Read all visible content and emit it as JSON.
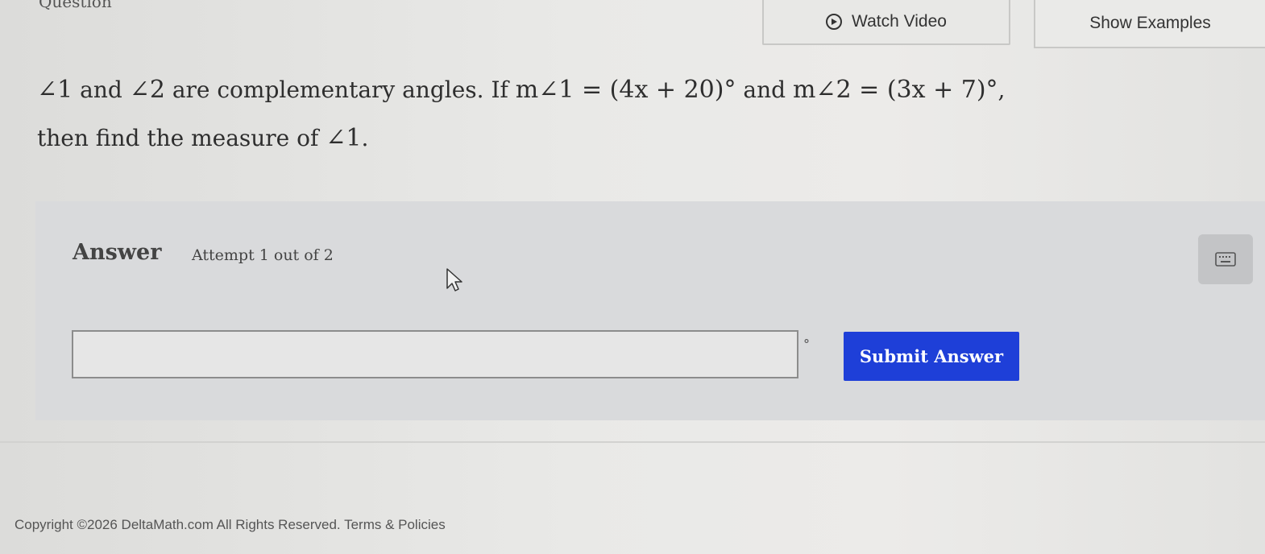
{
  "header": {
    "section_label": "Question",
    "watch_video_label": "Watch Video",
    "show_examples_label": "Show Examples"
  },
  "question": {
    "angle1": "∠1",
    "and1": " and ",
    "angle2": "∠2",
    "text1": " are complementary angles. If ",
    "m_angle1": "m∠1 = (4x + 20)°",
    "and2": " and ",
    "m_angle2": "m∠2 = (3x + 7)°",
    "comma": ",",
    "text2": "then find the measure of ",
    "target_angle": "∠1",
    "period": "."
  },
  "answer": {
    "title": "Answer",
    "attempt": "Attempt 1 out of 2",
    "input_value": "",
    "unit": "°",
    "submit_label": "Submit Answer"
  },
  "footer": {
    "copyright": "Copyright ©2026 DeltaMath.com All Rights Reserved.",
    "terms_link": "Terms & Policies"
  },
  "colors": {
    "submit_button": "#1e3fd8",
    "answer_panel": "#d9dadc",
    "page_background": "#e6e6e4"
  },
  "icons": {
    "video": "play-circle-icon",
    "keyboard": "keyboard-icon",
    "cursor": "mouse-pointer-icon"
  }
}
